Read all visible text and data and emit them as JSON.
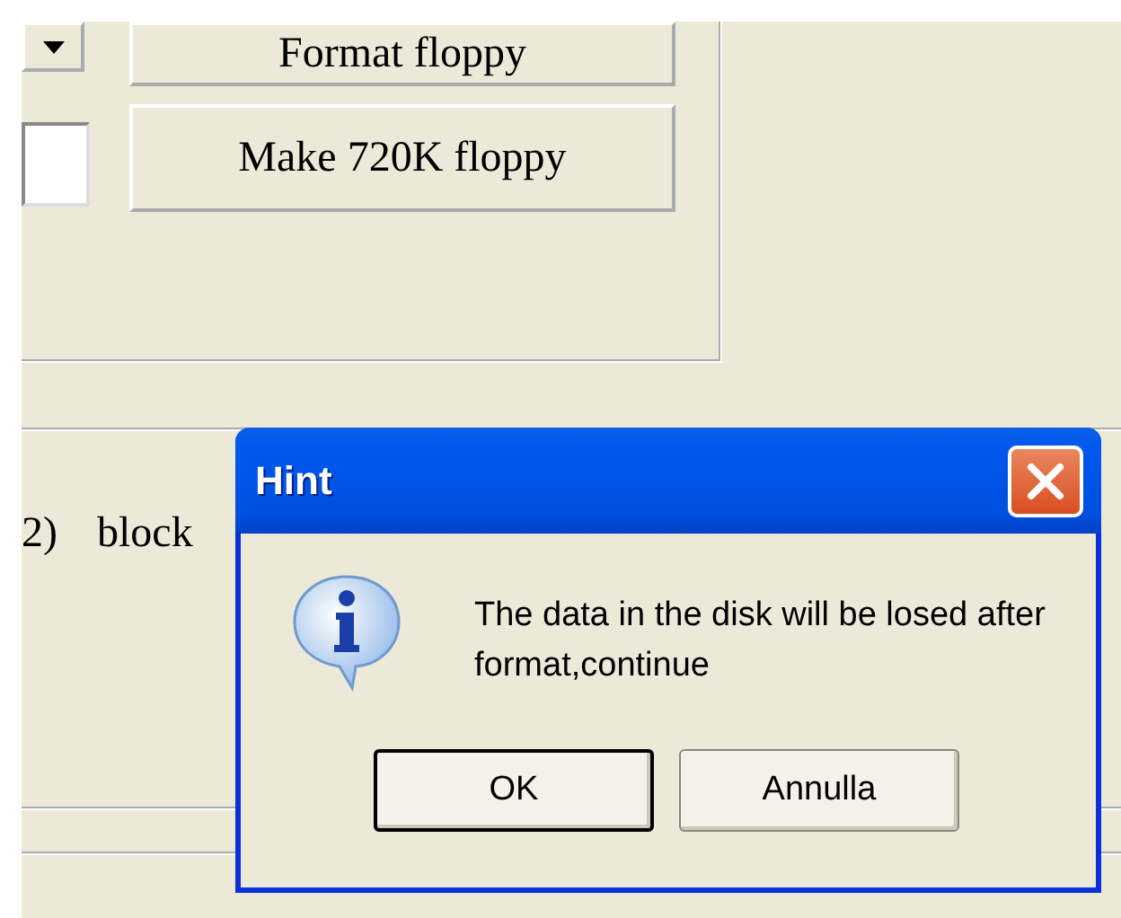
{
  "buttons": [
    {
      "label": "Format floppy"
    },
    {
      "label": "Make 720K floppy"
    }
  ],
  "log_text": [
    "2)",
    "block"
  ],
  "dialog": {
    "title": "Hint",
    "message": "The data in the disk will be losed after format,continue",
    "buttons": [
      {
        "label": "OK",
        "focused": true
      },
      {
        "label": "Annulla",
        "focused": false
      }
    ]
  }
}
